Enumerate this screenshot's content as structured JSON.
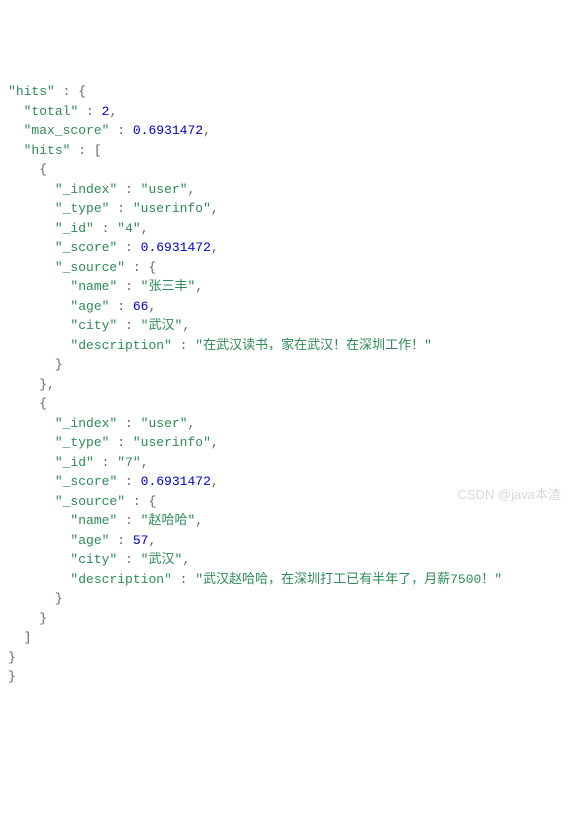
{
  "json": {
    "hits_key": "hits",
    "total_key": "total",
    "total_val": "2",
    "max_score_key": "max_score",
    "max_score_val": "0.6931472",
    "inner_hits_key": "hits",
    "items": [
      {
        "index_key": "_index",
        "index_val": "user",
        "type_key": "_type",
        "type_val": "userinfo",
        "id_key": "_id",
        "id_val": "4",
        "score_key": "_score",
        "score_val": "0.6931472",
        "source_key": "_source",
        "name_key": "name",
        "name_val": "张三丰",
        "age_key": "age",
        "age_val": "66",
        "city_key": "city",
        "city_val": "武汉",
        "desc_key": "description",
        "desc_val": "在武汉读书，家在武汉！在深圳工作！"
      },
      {
        "index_key": "_index",
        "index_val": "user",
        "type_key": "_type",
        "type_val": "userinfo",
        "id_key": "_id",
        "id_val": "7",
        "score_key": "_score",
        "score_val": "0.6931472",
        "source_key": "_source",
        "name_key": "name",
        "name_val": "赵哈哈",
        "age_key": "age",
        "age_val": "57",
        "city_key": "city",
        "city_val": "武汉",
        "desc_key": "description",
        "desc_val": "武汉赵哈哈，在深圳打工已有半年了，月薪7500！"
      }
    ]
  },
  "watermark": "CSDN @java本渣"
}
